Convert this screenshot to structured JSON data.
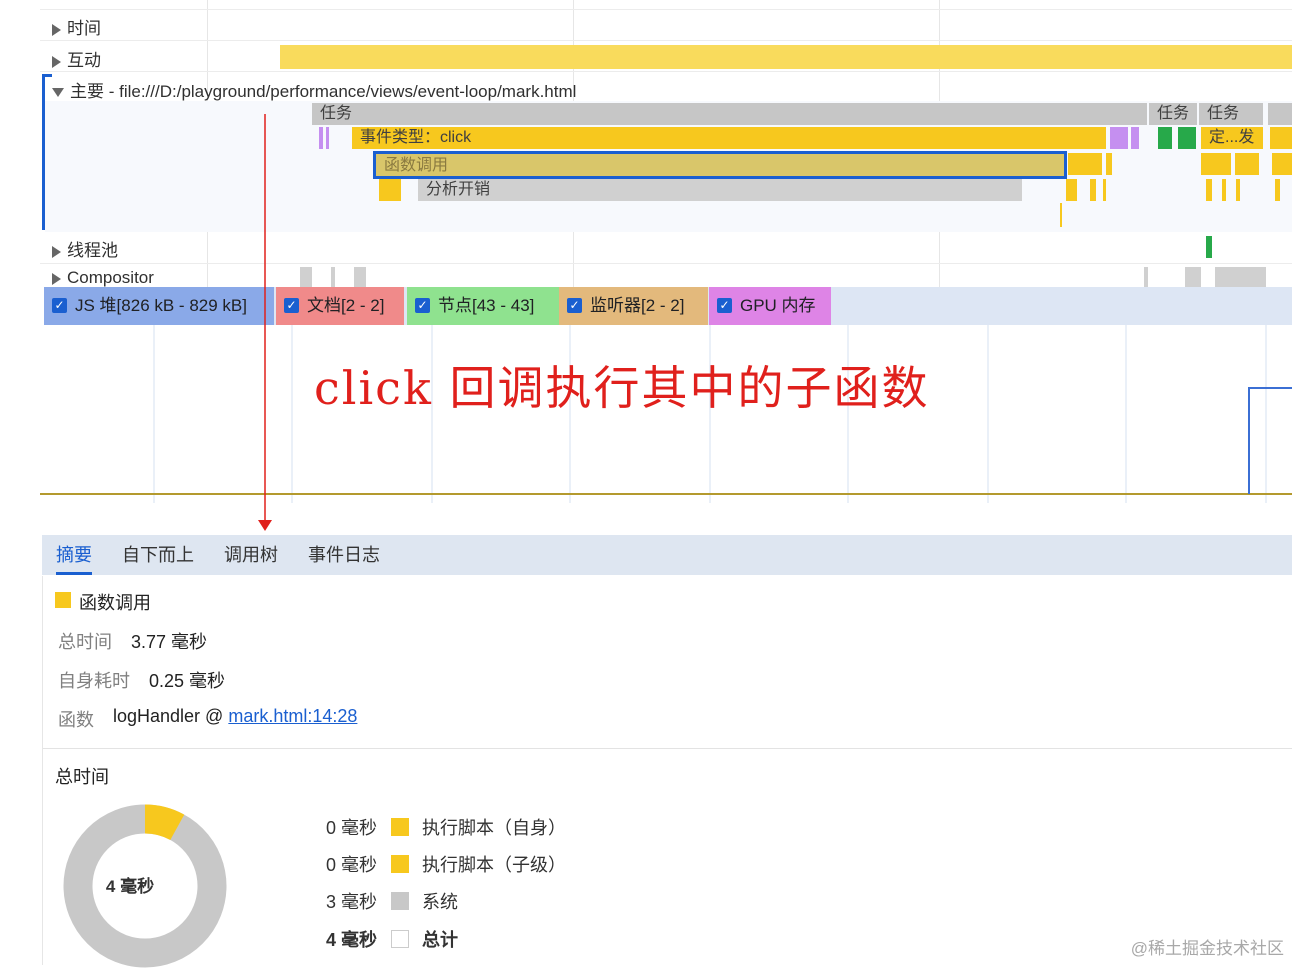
{
  "tracks": {
    "time_label": "时间",
    "interaction_label": "互动",
    "main_label": "主要 - file:///D:/playground/performance/views/event-loop/mark.html",
    "threadpool_label": "线程池",
    "compositor_label": "Compositor"
  },
  "flame": {
    "task": "任务",
    "task2": "任务",
    "task3": "任务",
    "event": "事件类型：click",
    "event_short": "定...发",
    "function_call": "函数调用",
    "profiling": "分析开销"
  },
  "counters": [
    {
      "label": "JS 堆[826 kB - 829 kB]",
      "color": "#8aa9e8"
    },
    {
      "label": "文档[2 - 2]",
      "color": "#f08a8a"
    },
    {
      "label": "节点[43 - 43]",
      "color": "#8fe28f"
    },
    {
      "label": "监听器[2 - 2]",
      "color": "#e3b97c"
    },
    {
      "label": "GPU 内存",
      "color": "#de84e6"
    }
  ],
  "annotation": "click 回调执行其中的子函数",
  "tabs": [
    "摘要",
    "自下而上",
    "调用树",
    "事件日志"
  ],
  "summary": {
    "title": "函数调用",
    "title_color": "#f7c81e",
    "total_time_key": "总时间",
    "total_time_val": "3.77 毫秒",
    "self_time_key": "自身耗时",
    "self_time_val": "0.25 毫秒",
    "function_key": "函数",
    "function_val": "logHandler @ ",
    "function_link": "mark.html:14:28",
    "section_title": "总时间",
    "donut_center": "4 毫秒",
    "legend": [
      {
        "value": "0 毫秒",
        "label": "执行脚本（自身）",
        "color": "#f7c81e"
      },
      {
        "value": "0 毫秒",
        "label": "执行脚本（子级）",
        "color": "#f7c81e"
      },
      {
        "value": "3 毫秒",
        "label": "系统",
        "color": "#c8c8c8"
      },
      {
        "value": "4 毫秒",
        "label": "总计",
        "color": "#ffffff"
      }
    ]
  },
  "watermark": "@稀土掘金技术社区"
}
